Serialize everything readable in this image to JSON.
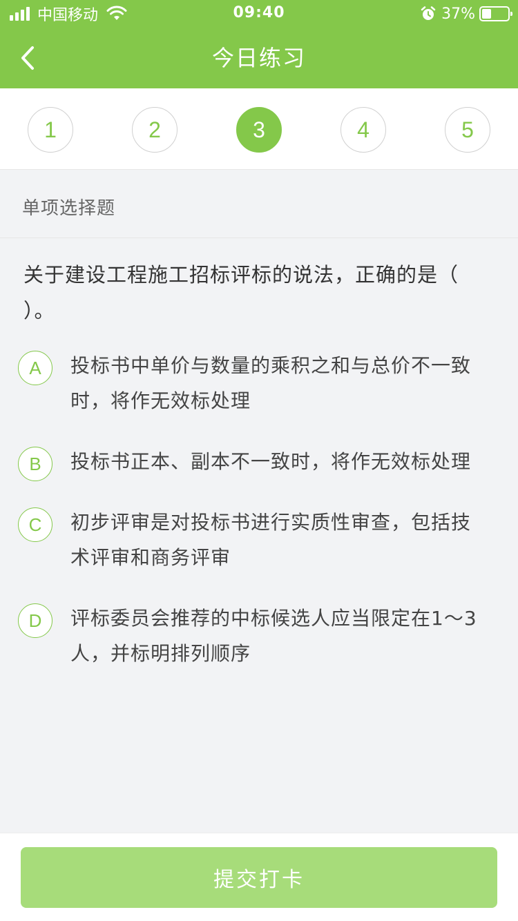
{
  "status_bar": {
    "carrier": "中国移动",
    "time": "09:40",
    "battery": "37%",
    "battery_level": 0.37,
    "icons": [
      "signal-icon",
      "wifi-icon",
      "alarm-icon",
      "battery-icon"
    ]
  },
  "header": {
    "title": "今日练习",
    "back_icon": "chevron-left-icon"
  },
  "steps": {
    "items": [
      "1",
      "2",
      "3",
      "4",
      "5"
    ],
    "active": "3"
  },
  "question": {
    "type": "单项选择题",
    "text": "关于建设工程施工招标评标的说法，正确的是（ ）。",
    "options": [
      {
        "letter": "A",
        "text": "投标书中单价与数量的乘积之和与总价不一致时，将作无效标处理"
      },
      {
        "letter": "B",
        "text": "投标书正本、副本不一致时，将作无效标处理"
      },
      {
        "letter": "C",
        "text": "初步评审是对投标书进行实质性审查，包括技术评审和商务评审"
      },
      {
        "letter": "D",
        "text": "评标委员会推荐的中标候选人应当限定在1～3人，并标明排列顺序"
      }
    ]
  },
  "footer": {
    "submit_label": "提交打卡"
  },
  "colors": {
    "accent": "#84c84a",
    "button_disabled": "#a7dc7a",
    "background": "#f2f3f5"
  }
}
